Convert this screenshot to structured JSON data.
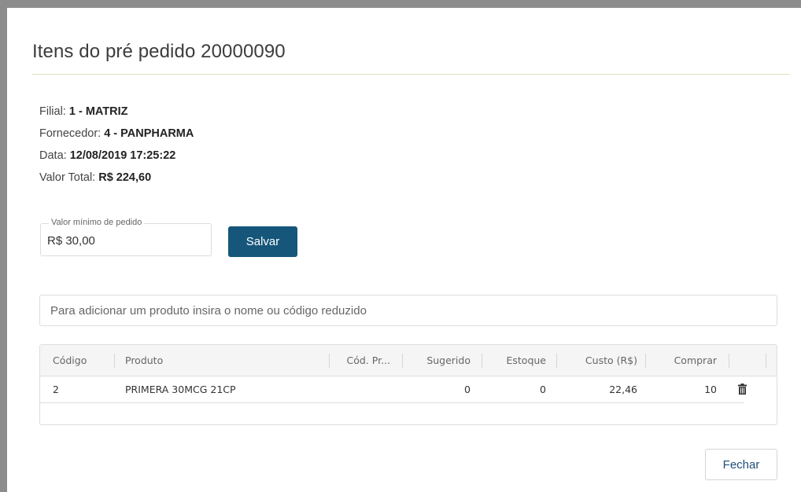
{
  "title": "Itens do pré pedido 20000090",
  "info": {
    "filial_label": "Filial: ",
    "filial_value": "1 - MATRIZ",
    "fornecedor_label": "Fornecedor: ",
    "fornecedor_value": "4 - PANPHARMA",
    "data_label": "Data: ",
    "data_value": "12/08/2019 17:25:22",
    "valor_label": "Valor Total: ",
    "valor_value": "R$ 224,60"
  },
  "min_order": {
    "legend": "Valor mínimo de pedido",
    "value": "R$ 30,00"
  },
  "save_label": "Salvar",
  "search": {
    "placeholder": "Para adicionar um produto insira o nome ou código reduzido"
  },
  "table": {
    "headers": [
      "Código",
      "Produto",
      "Cód. Pr...",
      "Sugerido",
      "Estoque",
      "Custo (R$)",
      "Comprar"
    ],
    "rows": [
      {
        "codigo": "2",
        "produto": "PRIMERA 30MCG 21CP",
        "cod_pr": "",
        "sugerido": "0",
        "estoque": "0",
        "custo": "22,46",
        "comprar": "10"
      }
    ]
  },
  "close_label": "Fechar",
  "icons": {
    "delete": "trash-icon"
  },
  "colors": {
    "primary_button": "#16567a",
    "title_rule": "#d9e2b8"
  }
}
